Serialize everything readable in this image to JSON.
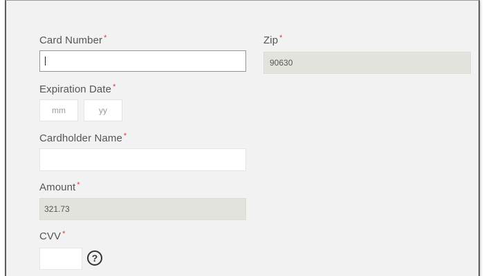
{
  "form": {
    "card_number": {
      "label": "Card Number",
      "required": "*",
      "value": ""
    },
    "zip": {
      "label": "Zip",
      "required": "*",
      "value": "90630"
    },
    "expiration": {
      "label": "Expiration Date",
      "required": "*",
      "month_placeholder": "mm",
      "year_placeholder": "yy"
    },
    "cardholder": {
      "label": "Cardholder Name",
      "required": "*",
      "value": ""
    },
    "amount": {
      "label": "Amount",
      "required": "*",
      "value": "321.73"
    },
    "cvv": {
      "label": "CVV",
      "required": "*",
      "value": "",
      "help_glyph": "?"
    }
  },
  "colors": {
    "required_asterisk": "#e03a3a",
    "focus_border": "#6f9ad6",
    "disabled_bg": "#e3e3de"
  },
  "icons": {
    "cvv_help": "question-circle-icon"
  }
}
